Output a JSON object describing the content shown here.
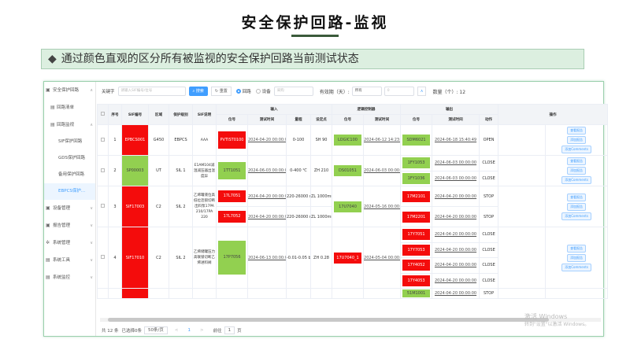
{
  "slide": {
    "title": "安全保护回路-监视",
    "banner_icon": "◆",
    "banner": "通过颜色直观的区分所有被监视的安全保护回路当前测试状态"
  },
  "sidebar": [
    {
      "label": "安全保护回路",
      "icon": "▣",
      "arrow": "∧",
      "level": 0
    },
    {
      "label": "回路清单",
      "icon": "▤",
      "level": 1
    },
    {
      "label": "回路监视",
      "icon": "▤",
      "arrow": "∧",
      "level": 1
    },
    {
      "label": "SIF保护回路",
      "level": 2
    },
    {
      "label": "GDS保护回路",
      "level": 2
    },
    {
      "label": "备用保护回路",
      "level": 2
    },
    {
      "label": "EBPCS保护...",
      "level": 2,
      "active": true
    },
    {
      "label": "设备管理",
      "icon": "▣",
      "arrow": "∨",
      "level": 0
    },
    {
      "label": "报告管理",
      "icon": "▣",
      "arrow": "∨",
      "level": 0
    },
    {
      "label": "系统管理",
      "icon": "✲",
      "arrow": "∨",
      "level": 0
    },
    {
      "label": "系统工具",
      "icon": "▤",
      "arrow": "∨",
      "level": 0
    },
    {
      "label": "系统监控",
      "icon": "▤",
      "arrow": "∨",
      "level": 0
    }
  ],
  "filter": {
    "keyword_label": "关键字",
    "keyword_placeholder": "请输入SIF编号/位号",
    "search": "搜索",
    "reset": "重置",
    "opt1": "回路",
    "opt2": "设备",
    "sel1": "采购",
    "validity_label": "有效期（天）:",
    "sel2": "所有",
    "num": "0",
    "count_label": "数量（个）: 12"
  },
  "headers": {
    "seq": "序号",
    "sif": "SIF编号",
    "area": "区域",
    "level": "保护级别",
    "desc": "SIF说明",
    "input": "输入",
    "logic": "逻辑控制器",
    "output": "输出",
    "op": "操作",
    "tag": "位号",
    "time": "测试时间",
    "range": "量程",
    "setpoint": "设定点",
    "action": "动作"
  },
  "ops": {
    "view": "查看报告",
    "add": "添加报告",
    "comment": "添加Comments"
  },
  "rows": [
    {
      "seq": "1",
      "sif": "EPBCS001",
      "sif_c": "red",
      "area": "G450",
      "level": "EBPCS",
      "desc": "AAA",
      "ins": [
        {
          "tag": "PVTIST0100",
          "c": "red",
          "time": "2024-04-20 00:00:00",
          "range": "0-100",
          "sp": "SH 90"
        }
      ],
      "logic": {
        "tag": "LOGIC100",
        "c": "grn",
        "time": "2024-06-12 14:23:52"
      },
      "outs": [
        {
          "tag": "SDM6021",
          "c": "grn",
          "time": "2024-06-18 15:40:49",
          "act": "OPEN"
        }
      ]
    },
    {
      "seq": "2",
      "sif": "SP00003",
      "sif_c": "grn",
      "area": "UT",
      "level": "SIL 1",
      "desc": "E1AM104减温减压器出温度异",
      "ins": [
        {
          "tag": "1TT1051",
          "c": "grn",
          "time": "2024-06-03 00:00:00",
          "range": "0-400 ℃",
          "sp": "ZH 210"
        }
      ],
      "logic": {
        "tag": "DS01051",
        "c": "grn",
        "time": "2024-06-03 00:00:00"
      },
      "outs": [
        {
          "tag": "1FY1053",
          "c": "grn",
          "time": "2024-06-03 00:00:00",
          "act": "CLOSE"
        },
        {
          "tag": "1FY1036",
          "c": "grn",
          "time": "2024-06-03 00:00:00",
          "act": "CLOSE"
        }
      ]
    },
    {
      "seq": "3",
      "sif": "SIF17003",
      "sif_c": "red",
      "area": "C2",
      "level": "SIL 2",
      "desc": "乙烯罐液位高低位连锁切断出料泵17PA 210/17PA 220",
      "ins": [
        {
          "tag": "17L7051",
          "c": "red",
          "time": "2024-04-20 00:00:00",
          "range": "220-26000 m",
          "sp": "ZL 1000mm"
        },
        {
          "tag": "17L7052",
          "c": "red",
          "time": "2024-04-20 00:00:00",
          "range": "220-26000 m",
          "sp": "ZL 1000mm"
        }
      ],
      "logic": {
        "tag": "17U7040",
        "c": "grn",
        "time": "2024-05-16 00:00:00"
      },
      "outs": [
        {
          "tag": "17M2101",
          "c": "red",
          "time": "2024-04-20 00:00:00",
          "act": "STOP"
        },
        {
          "tag": "17M2201",
          "c": "red",
          "time": "2024-04-20 00:00:00",
          "act": "STOP"
        }
      ]
    },
    {
      "seq": "4",
      "sif": "SIF17010",
      "sif_c": "red",
      "area": "C2",
      "level": "SIL 2",
      "desc": "乙烯储罐压力高联锁切断乙烯进料阀",
      "ins": [
        {
          "tag": "17P7056",
          "c": "grn",
          "time": "2024-06-13 00:00:00",
          "range": "-0.01-0.05 ba",
          "sp": "ZH 0.28"
        }
      ],
      "logic": {
        "tag": "17U7040_1",
        "c": "red",
        "time": "2024-05-04 00:00:00"
      },
      "outs": [
        {
          "tag": "17Y7051",
          "c": "red",
          "time": "2024-04-20 00:00:00",
          "act": "CLOSE"
        },
        {
          "tag": "17Y7053",
          "c": "red",
          "time": "2024-04-20 00:00:00",
          "act": "CLOSE"
        },
        {
          "tag": "17Y4052",
          "c": "red",
          "time": "2024-04-20 00:00:00",
          "act": "CLOSE"
        },
        {
          "tag": "17Y4053",
          "c": "red",
          "time": "2024-04-20 00:00:00",
          "act": "CLOSE"
        }
      ]
    },
    {
      "seq": "",
      "sif": "",
      "sif_c": "red",
      "area": "",
      "level": "",
      "desc": "",
      "ins": [],
      "logic": {
        "tag": "",
        "c": "",
        "time": ""
      },
      "outs": [
        {
          "tag": "51M1001",
          "c": "grn",
          "time": "2024-04-20 00:00:00",
          "act": "STOP"
        }
      ]
    }
  ],
  "footer": {
    "total": "共 12 条",
    "selected": "已选择0条",
    "page_size": "50条/页",
    "prev": "<",
    "page": "1",
    "next": ">",
    "goto": "前往",
    "goto_page": "1",
    "page_unit": "页"
  },
  "watermark": {
    "l1": "激活 Windows",
    "l2": "转到\"设置\"以激活 Windows。"
  }
}
